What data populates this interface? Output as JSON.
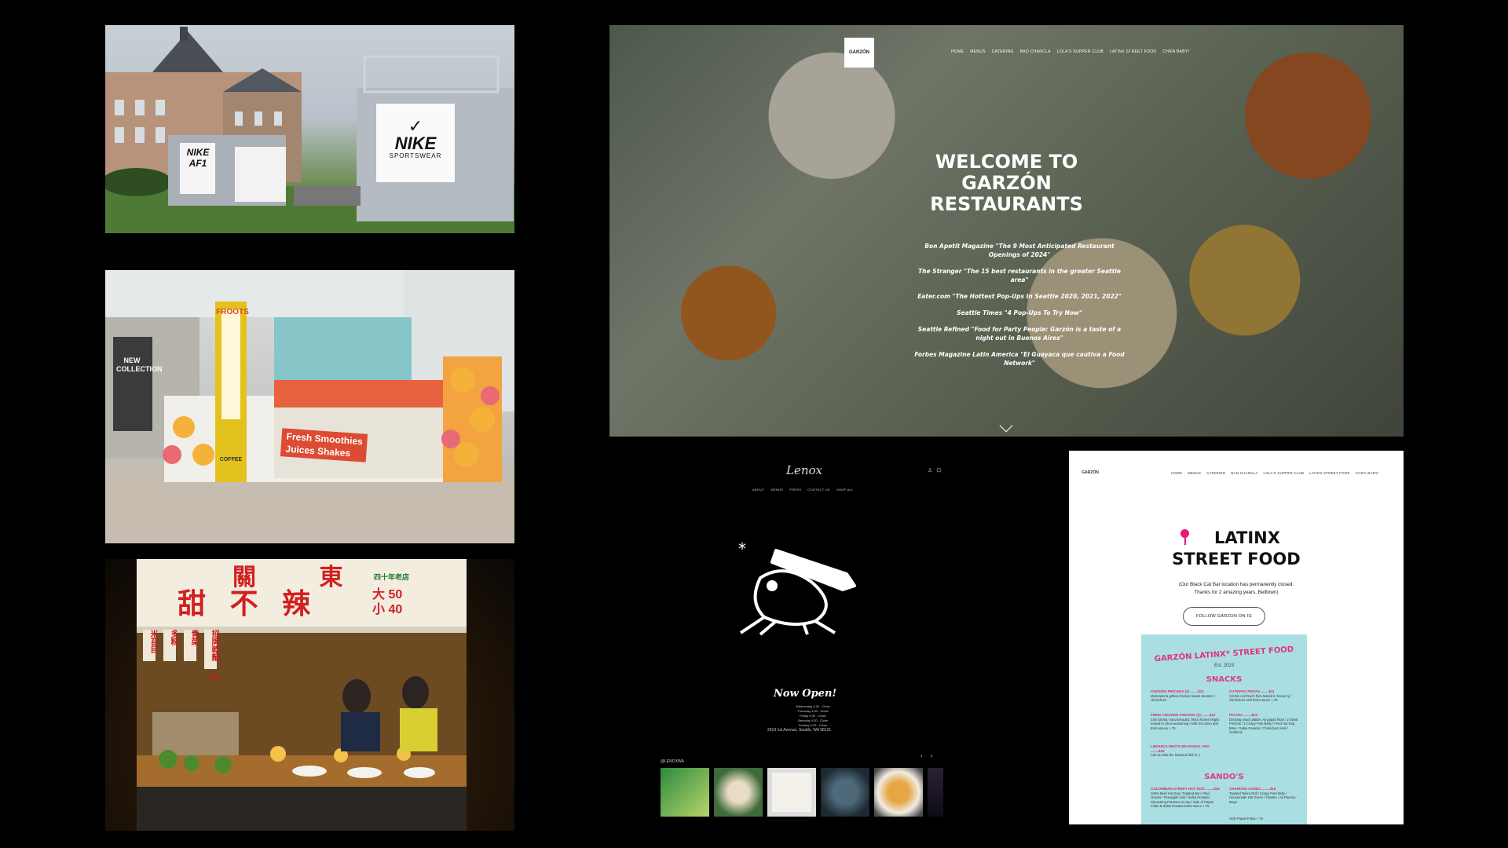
{
  "garzon_site": {
    "logo_text": "GARZÓN",
    "nav": [
      "HOME",
      "MENUS",
      "CATERING",
      "BAO CHANCLA",
      "LOLA'S SUPPER CLUB",
      "LATINX STREET FOOD",
      "CHIFA BABY!"
    ],
    "hero_title_lines": [
      "WELCOME TO",
      "GARZÓN",
      "RESTAURANTS"
    ],
    "press_quotes": [
      "Bon Apetit Magazine \"The 9 Most Anticipated Restaurant Openings of 2024\"",
      "The Stranger \"The 15 best restaurants in the greater Seattle area\"",
      "Eater.com \"The Hottest Pop-Ups In Seattle 2020, 2021, 2022\"",
      "Seattle Times \"4 Pop-Ups To Try Now\"",
      "Seattle Refined \"Food for Party People: Garzón is a taste of a night out in Buenos Aires\"",
      "Forbes Magazine Latin America \"El Guayaca que cautiva a Food Network\""
    ]
  },
  "lenox_site": {
    "logo_text": "Lenox",
    "nav": [
      "ABOUT",
      "MENUS",
      "PRESS",
      "CONTACT US",
      "SHOP ALL"
    ],
    "headline": "Now Open!",
    "hours": [
      "Wednesday 4:30 - Close",
      "Thursday 4:30 - Close",
      "Friday 4:30 - Close",
      "Saturday 4:30 - Close",
      "Sunday 4:30 - Close"
    ],
    "address": "2619 1st Avenue, Seattle, WA 98121",
    "instagram_handle": "@LENOXWA",
    "thumbnail_count": 6
  },
  "latinx_site": {
    "logo_text": "GARZÓN",
    "nav": [
      "HOME",
      "MENUS",
      "CATERING",
      "BAO CHANCLA",
      "LOLA'S SUPPER CLUB",
      "LATINX STREET FOOD",
      "CHIFA BABY!"
    ],
    "title_lines": [
      "LATINX",
      "STREET FOOD"
    ],
    "notice_lines": [
      "(Our Black Cat Bar location has permanently closed.",
      "Thanks for 2 amazing years, Belltown)"
    ],
    "follow_button": "FOLLOW GARZON ON IG",
    "menu": {
      "title": "GARZÓN LATINX* STREET FOOD",
      "est": "Est. 2019",
      "sections": [
        "SNACKS",
        "SANDO'S"
      ],
      "items": [
        {
          "name": "CHICKEN PINCHOS (2) ........$12",
          "desc": "Marinated & grilled chicken breast skewers / chimichurri"
        },
        {
          "name": "OJ PAPAS FRITAS ........$11",
          "desc": "Crinkle cut french fries tossed in house oj / chimichurri aioli Extra sauce +.75"
        },
        {
          "name": "FRIED CHICKEN PINCHOS (2) ........$12",
          "desc": "24hr brined, hand breaded, fried chicken thighs tossed in citrus seasoning / with red onion aioli Extra sauce +.75"
        },
        {
          "name": "PICADA ........$23",
          "desc": "Drinking snack platter: Aji papas fritas / 2 Steak Pinchos / 2 Crispy Pork Belly / Fried Hot Dog Bites / Salsa Rosada / Chimichurri Aioli / Scallions"
        },
        {
          "name": "LINGUIÇA WHO'S SEASONAL VEG ........$15",
          "desc": "Ask us what the featured dish is :)"
        },
        {
          "name": "COLOMBIAN STREET HOT DOG ........$15",
          "desc": "100% Beef Hot Dog / Toasted Bun / Red Onions / Pineapple Aioli / Salsa Rosada / Shoestring Potatoes on top / Side of Papas Fritas & Salsa Rosada Extra sauce +.75"
        },
        {
          "name": "CHANCHO SANDO ........$16",
          "desc": "Toasted Telera Roll / Crispy Pork Belly / Housemade Hot Green / Cilantro / Aji Panela / Mayo"
        }
      ],
      "footnote": "ADD Papas Fritas +.75"
    }
  },
  "photos": {
    "nike": {
      "sign_main": "NIKE",
      "sign_sub": "SPORTSWEAR",
      "sign_left_1": "NIKE",
      "sign_left_2": "AF1"
    },
    "froots": {
      "brand": "FROOTS",
      "counter_text_1": "Fresh Smoothies",
      "counter_text_2": "Juices  Shakes",
      "coffee_label": "COFFEE",
      "store_sign": "NEW COLLECTION"
    },
    "stall": {
      "title_1": "關",
      "title_2": "東",
      "title_3": "甜",
      "title_4": "不",
      "title_5": "辣",
      "size_big": "大",
      "size_small": "小",
      "price_big": "50",
      "price_small": "40",
      "shop_tag": "四十年老店",
      "sides": [
        "米苔目",
        "多粉",
        "青菜",
        "招牌乾麵"
      ],
      "side_price": "30"
    }
  },
  "colors": {
    "background": "#000000",
    "pink_accent": "#e6197a",
    "menu_bg": "#a9dfe3"
  }
}
